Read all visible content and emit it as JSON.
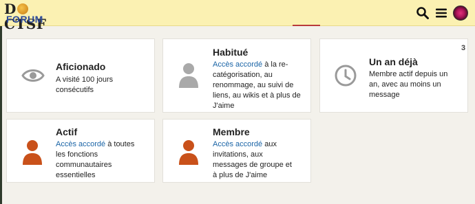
{
  "header": {
    "logo_top_left": "D",
    "logo_top_right": "CTSF",
    "logo_bottom": "FORUM",
    "icons": [
      "search-icon",
      "menu-icon",
      "user-avatar"
    ]
  },
  "badges": [
    {
      "title": "Aficionado",
      "icon": "eye-icon",
      "desc": "A visité 100 jours consécutifs"
    },
    {
      "title": "Habitué",
      "icon": "user-icon",
      "accent": "Accès accordé",
      "desc": " à la re-catégorisation, au renommage, au suivi de liens, au wikis et à plus de J'aime"
    },
    {
      "title": "Un an déjà",
      "icon": "clock-icon",
      "desc": "Membre actif depuis un an, avec au moins un message",
      "count": "3"
    },
    {
      "title": "Actif",
      "icon": "user-icon",
      "accent": "Accès accordé",
      "desc": " à toutes les fonctions communautaires essentielles"
    },
    {
      "title": "Membre",
      "icon": "user-icon",
      "accent": "Accès accordé",
      "desc": " aux invitations, aux messages de groupe et à plus de J'aime"
    }
  ],
  "colors": {
    "header_bg": "#fbf1b2",
    "accent": "#1a64a6",
    "user_orange": "#c9511a",
    "user_grey": "#a9a9a9"
  }
}
